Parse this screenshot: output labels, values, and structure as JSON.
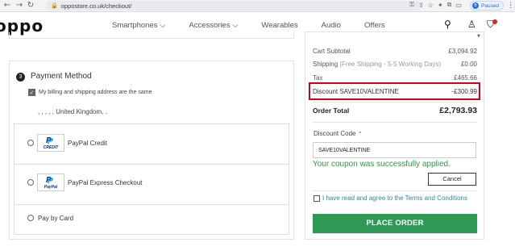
{
  "browser": {
    "url": "oppostore.co.uk/checkout/",
    "profile_status": "Paused",
    "profile_initial": "B"
  },
  "header": {
    "logo": "oppo",
    "nav": [
      "Smartphones ⌵",
      "Accessories ⌵",
      "Wearables",
      "Audio",
      "Offers"
    ]
  },
  "payment": {
    "step_number": "3",
    "title": "Payment Method",
    "same_address_label": "My billing and shipping address are the same",
    "address_line": ", , , , , United Kingdom, .",
    "options": [
      {
        "label": "PayPal Credit",
        "logo_text": "CREDIT"
      },
      {
        "label": "PayPal Express Checkout",
        "logo_text": "PayPal"
      },
      {
        "label": "Pay by Card"
      }
    ]
  },
  "summary": {
    "cart_subtotal_label": "Cart Subtotal",
    "cart_subtotal_value": "£3,094.92",
    "shipping_label": "Shipping",
    "shipping_note": "(Free Shipping - 5-5 Working Days)",
    "shipping_value": "£0.00",
    "tax_label": "Tax",
    "tax_value": "£465.66",
    "discount_label": "Discount SAVE10VALENTINE",
    "discount_value": "-£300.99",
    "total_label": "Order Total",
    "total_value": "£2,793.93",
    "discount_code_title": "Discount Code",
    "discount_code_value": "SAVE10VALENTINE",
    "success_message": "Your coupon was successfully applied.",
    "cancel_label": "Cancel",
    "terms_label": "I have read and agree to the Terms and Conditions",
    "place_order_label": "PLACE ORDER"
  },
  "colors": {
    "accent_green": "#2e9a56",
    "discount_highlight": "#d0021b"
  }
}
